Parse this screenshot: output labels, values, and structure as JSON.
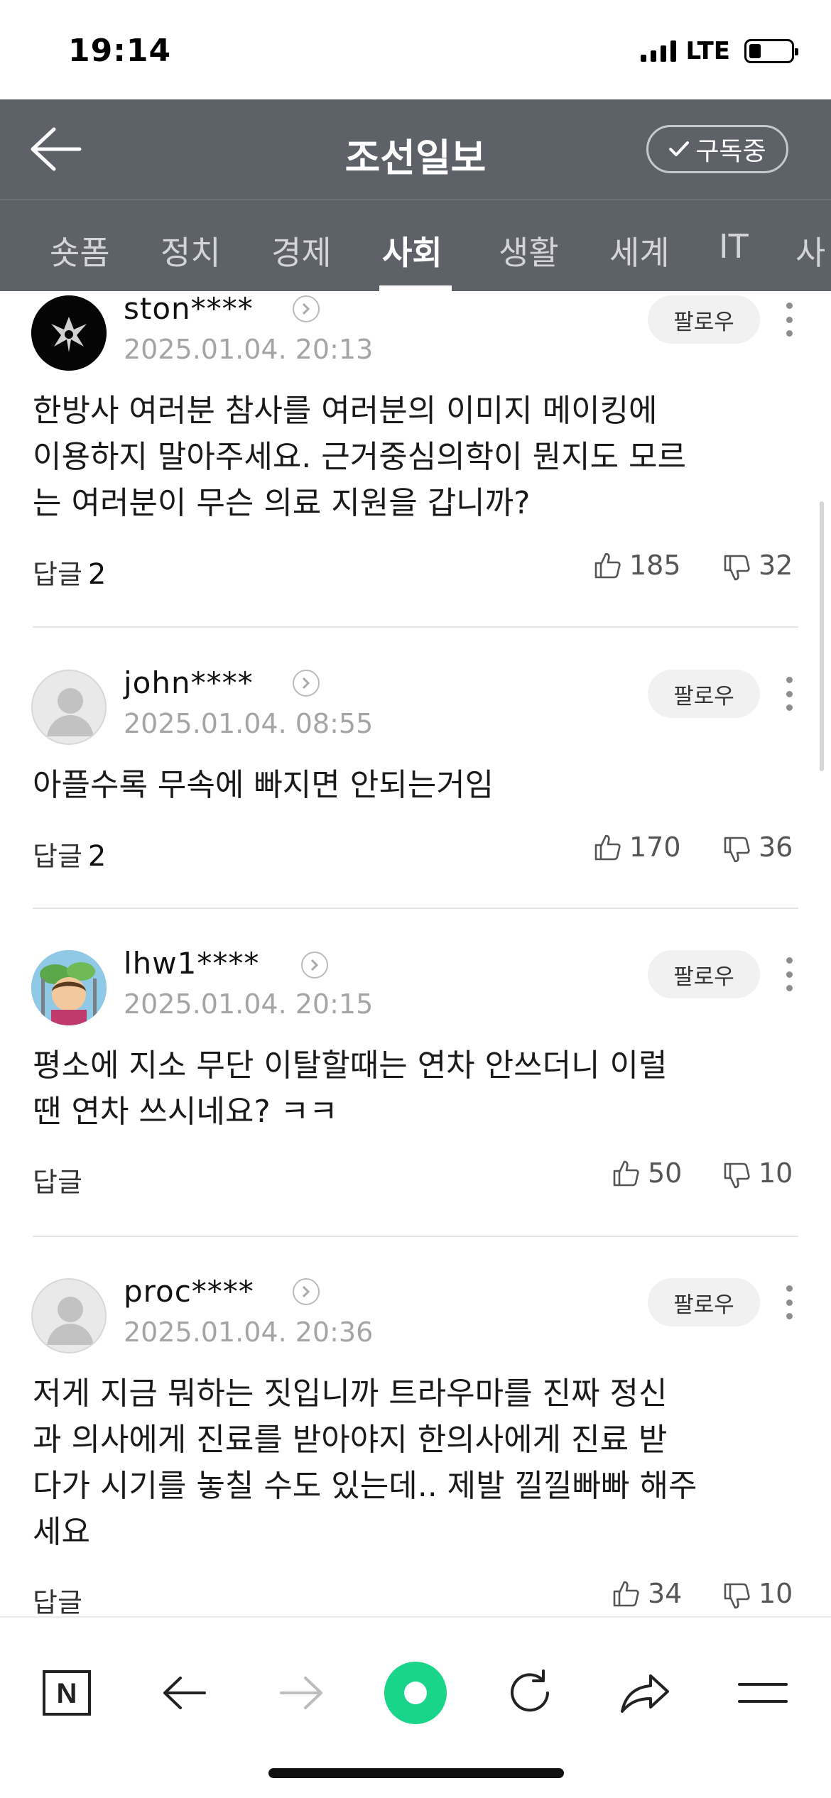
{
  "status": {
    "time": "19:14",
    "network": "LTE"
  },
  "header": {
    "title": "조선일보",
    "subscribe_label": "구독중"
  },
  "tabs": [
    {
      "label": "숏폼"
    },
    {
      "label": "정치"
    },
    {
      "label": "경제"
    },
    {
      "label": "사회",
      "active": true
    },
    {
      "label": "생활"
    },
    {
      "label": "세계"
    },
    {
      "label": "IT"
    },
    {
      "label": "사"
    }
  ],
  "comments": [
    {
      "username": "ston****",
      "date": "2025.01.04. 20:13",
      "follow_label": "팔로우",
      "lines": [
        "한방사 여러분 참사를 여러분의 이미지 메이킹에",
        "이용하지 말아주세요. 근거중심의학이 뭔지도 모르",
        "는 여러분이 무슨 의료 지원을 갑니까?"
      ],
      "reply_label": "답글",
      "reply_count": "2",
      "likes": "185",
      "dislikes": "32"
    },
    {
      "username": "john****",
      "date": "2025.01.04. 08:55",
      "follow_label": "팔로우",
      "lines": [
        "아플수록 무속에 빠지면 안되는거임"
      ],
      "reply_label": "답글",
      "reply_count": "2",
      "likes": "170",
      "dislikes": "36"
    },
    {
      "username": "lhw1****",
      "date": "2025.01.04. 20:15",
      "follow_label": "팔로우",
      "lines": [
        "평소에 지소 무단 이탈할때는 연차 안쓰더니 이럴",
        "땐 연차 쓰시네요? ㅋㅋ"
      ],
      "reply_label": "답글",
      "reply_count": "",
      "likes": "50",
      "dislikes": "10"
    },
    {
      "username": "proc****",
      "date": "2025.01.04. 20:36",
      "follow_label": "팔로우",
      "lines": [
        "저게 지금 뭐하는 짓입니까 트라우마를 진짜 정신",
        "과 의사에게 진료를 받아야지 한의사에게 진료 받",
        "다가 시기를 놓칠 수도 있는데.. 제발 낄낄빠빠 해주",
        "세요"
      ],
      "reply_label": "답글",
      "reply_count": "",
      "likes": "34",
      "dislikes": "10"
    }
  ],
  "toolbar": {
    "home_label": "N"
  },
  "colors": {
    "header_bg": "#5d6168",
    "green_button": "#19d58a",
    "muted_text": "#a5a5a5"
  },
  "icons": [
    "back-arrow-icon",
    "checkmark-icon",
    "profile-arrow-icon",
    "more-vertical-icon",
    "thumbs-up-icon",
    "thumbs-down-icon",
    "naver-home-icon",
    "browser-back-icon",
    "browser-forward-icon",
    "green-dot-icon",
    "refresh-icon",
    "share-icon",
    "menu-icon"
  ]
}
